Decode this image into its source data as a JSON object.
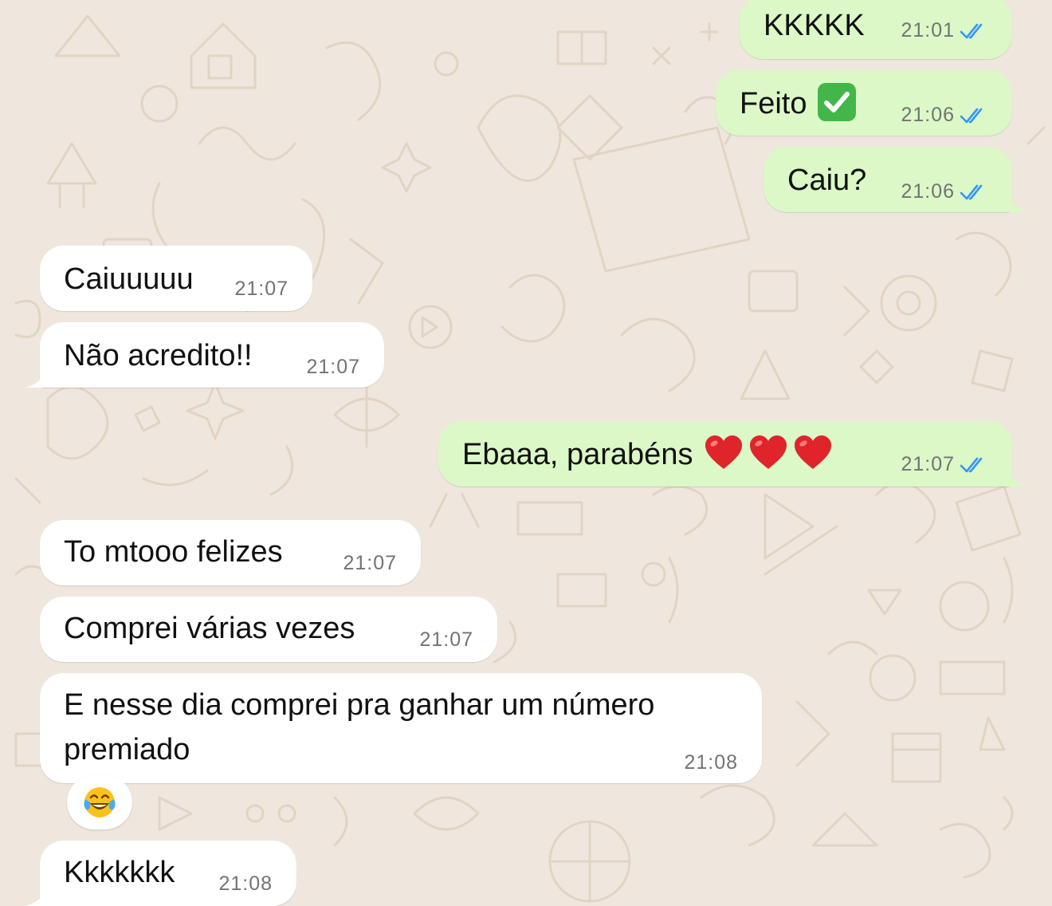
{
  "messages": [
    {
      "text": "KKKKK",
      "time": "21:01",
      "direction": "outgoing",
      "status": "read"
    },
    {
      "text": "Feito",
      "emoji": "check-mark-button-emoji",
      "time": "21:06",
      "direction": "outgoing",
      "status": "read"
    },
    {
      "text": "Caiu?",
      "time": "21:06",
      "direction": "outgoing",
      "status": "read"
    },
    {
      "text": "Caiuuuuu",
      "time": "21:07",
      "direction": "incoming"
    },
    {
      "text": "Não acredito!!",
      "time": "21:07",
      "direction": "incoming"
    },
    {
      "text": "Ebaaa, parabéns",
      "emoji": "red-heart-emoji x3",
      "time": "21:07",
      "direction": "outgoing",
      "status": "read"
    },
    {
      "text": "To mtooo felizes",
      "time": "21:07",
      "direction": "incoming"
    },
    {
      "text": "Comprei várias vezes",
      "time": "21:07",
      "direction": "incoming"
    },
    {
      "text": "E nesse dia comprei pra ganhar um número premiado",
      "time": "21:08",
      "direction": "incoming",
      "reaction": "face-with-tears-of-joy-emoji"
    },
    {
      "text": "Kkkkkkk",
      "time": "21:08",
      "direction": "incoming"
    }
  ],
  "colors": {
    "outgoing_bubble": "#dbf8c6",
    "incoming_bubble": "#ffffff",
    "read_ticks": "#3497f9",
    "wallpaper": "#efe7de",
    "timestamp": "#737373"
  }
}
